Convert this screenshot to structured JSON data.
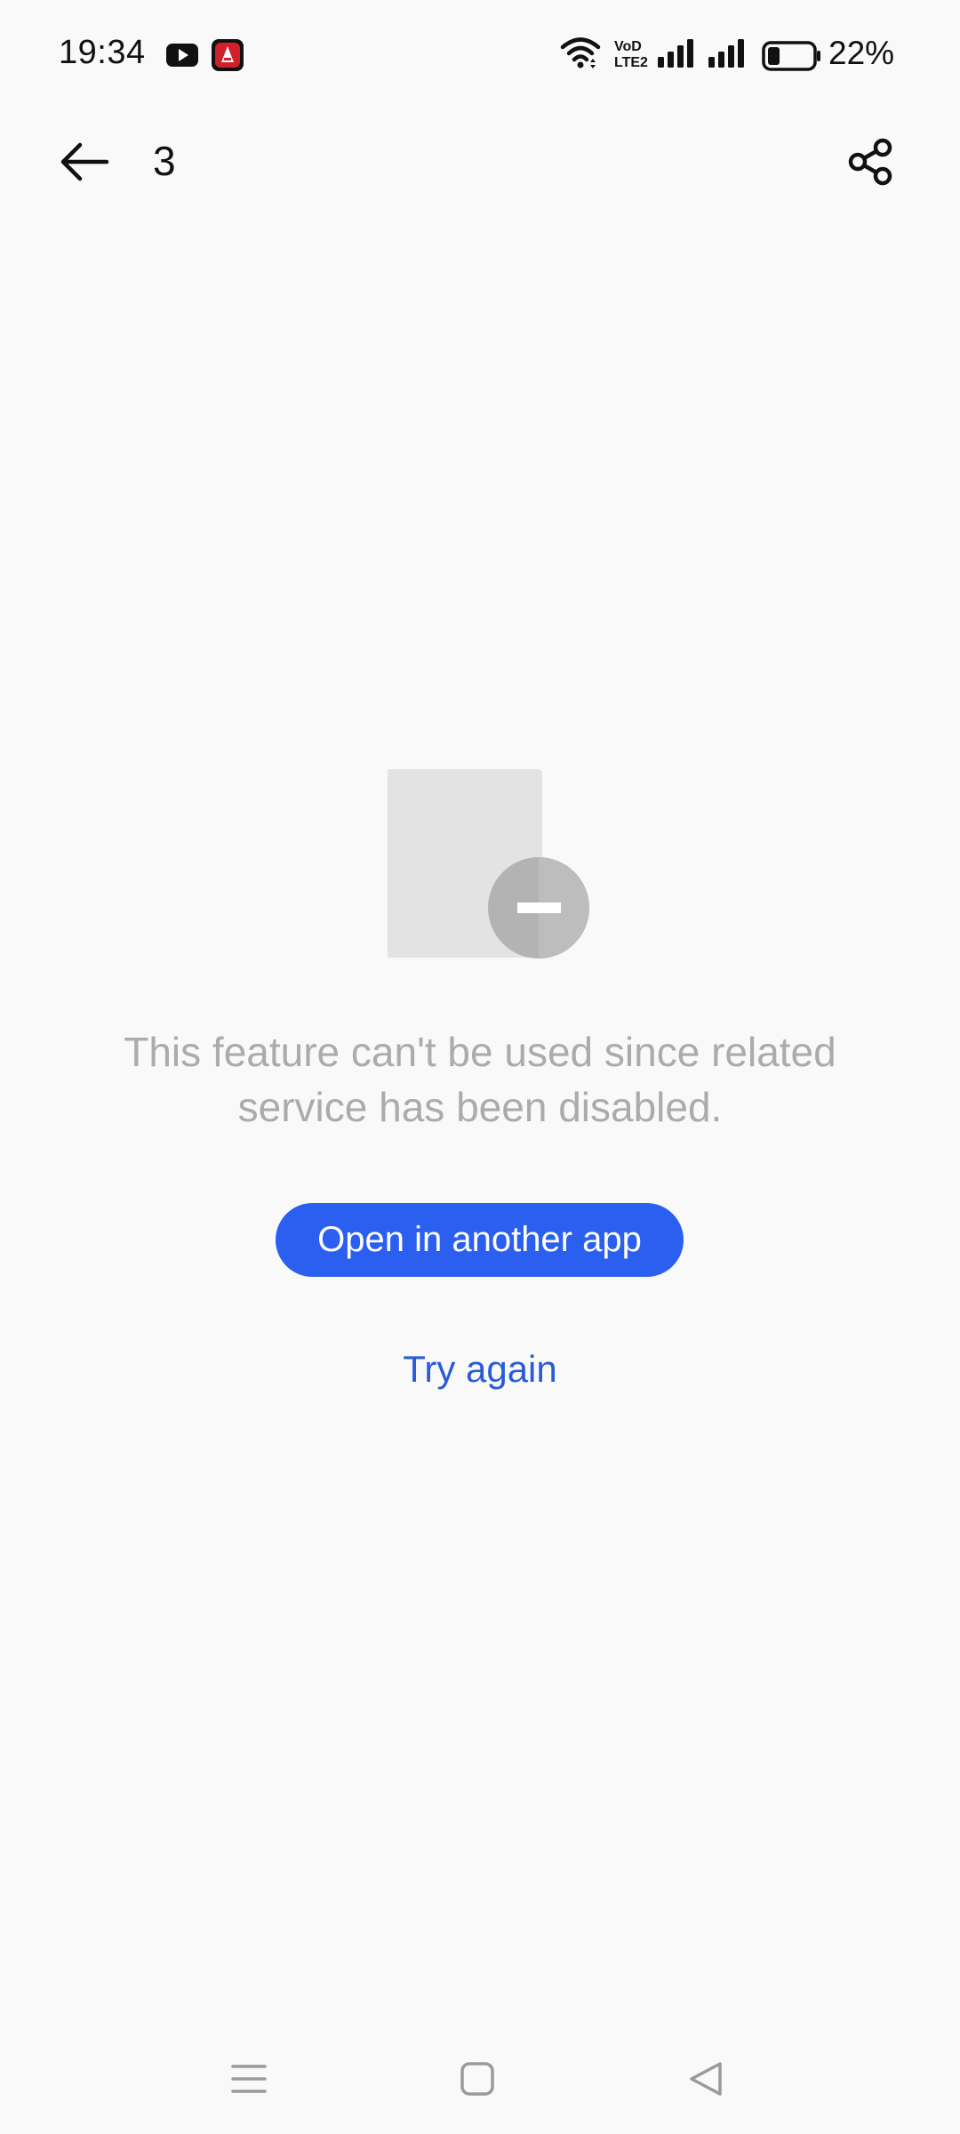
{
  "status_bar": {
    "time": "19:34",
    "battery_percent": "22%",
    "notification_icons": [
      "youtube-icon",
      "app-notification-icon"
    ],
    "indicators": [
      "wifi-icon",
      "volte-icon",
      "signal-icon",
      "signal-icon",
      "battery-icon"
    ]
  },
  "toolbar": {
    "title": "3",
    "back_icon": "arrow-left-icon",
    "share_icon": "share-icon"
  },
  "empty_state": {
    "illustration": "document-disabled-icon",
    "message": "This feature can't be used since related service has been disabled.",
    "primary_button_label": "Open in another app",
    "secondary_button_label": "Try again"
  },
  "nav_bar": {
    "icons": [
      "menu-icon",
      "home-icon",
      "back-triangle-icon"
    ]
  },
  "colors": {
    "accent": "#2a5ff0",
    "link": "#2a5bd7",
    "background": "#f9f9f9",
    "muted_text": "#ababab"
  }
}
